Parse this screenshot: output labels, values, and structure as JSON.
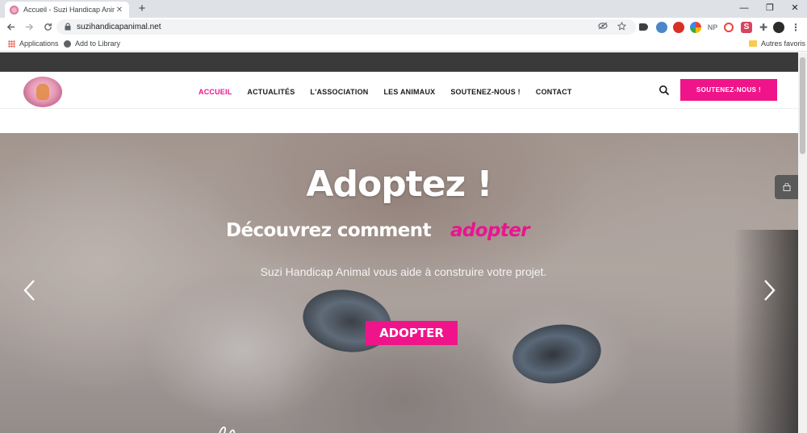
{
  "browser": {
    "tab": {
      "title": "Accueil - Suzi Handicap Animal",
      "close": "✕"
    },
    "new_tab": "+",
    "window_controls": {
      "minimize": "—",
      "maximize": "❐",
      "close": "✕"
    },
    "url": "suzihandicapanimal.net",
    "extensions": [
      "NP"
    ],
    "bookmarks": {
      "apps": "Applications",
      "add_to_library": "Add to Library",
      "other_favorites": "Autres favoris"
    }
  },
  "site": {
    "nav": [
      {
        "label": "ACCUEIL",
        "active": true
      },
      {
        "label": "ACTUALITÉS",
        "active": false
      },
      {
        "label": "L'ASSOCIATION",
        "active": false
      },
      {
        "label": "LES ANIMAUX",
        "active": false
      },
      {
        "label": "SOUTENEZ-NOUS !",
        "active": false
      },
      {
        "label": "CONTACT",
        "active": false
      }
    ],
    "cta_label": "SOUTENEZ-NOUS !",
    "accent_color": "#e8158f"
  },
  "hero": {
    "title": "Adoptez !",
    "subtitle": "Découvrez comment",
    "subtitle_accent": "adopter",
    "description": "Suzi Handicap Animal vous aide à construire votre projet.",
    "button": "ADOPTER"
  }
}
